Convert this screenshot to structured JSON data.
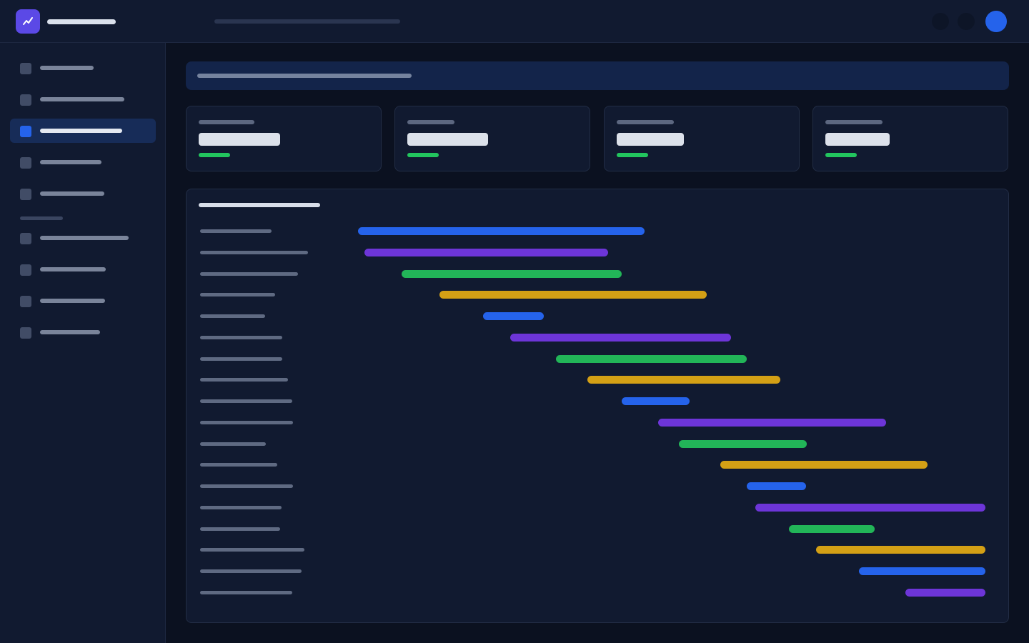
{
  "colors": {
    "accent": "#2563eb",
    "brand": "#5b49e6",
    "positive": "#22c55e",
    "bar_palette": [
      "#2563eb",
      "#6d35d8",
      "#22b558",
      "#d4a015"
    ]
  },
  "topbar": {
    "logo_icon": "trend-line-icon",
    "icons": [
      "circle-icon",
      "circle-icon"
    ],
    "avatar_icon": "avatar-icon"
  },
  "sidebar": {
    "active_index": 2,
    "groups": [
      {
        "items": [
          {
            "label": "",
            "icon": "square-icon"
          },
          {
            "label": "",
            "icon": "square-icon"
          },
          {
            "label": "",
            "icon": "square-icon"
          },
          {
            "label": "",
            "icon": "square-icon"
          },
          {
            "label": "",
            "icon": "square-icon"
          }
        ]
      },
      {
        "items": [
          {
            "label": "",
            "icon": "square-icon"
          },
          {
            "label": "",
            "icon": "square-icon"
          },
          {
            "label": "",
            "icon": "square-icon"
          },
          {
            "label": "",
            "icon": "square-icon"
          }
        ]
      }
    ]
  },
  "stats": [
    {
      "label": "",
      "value": "",
      "delta": ""
    },
    {
      "label": "",
      "value": "",
      "delta": ""
    },
    {
      "label": "",
      "value": "",
      "delta": ""
    },
    {
      "label": "",
      "value": "",
      "delta": ""
    }
  ],
  "chart_data": {
    "type": "gantt",
    "title": "",
    "xlabel": "",
    "ylabel": "",
    "xlim": [
      0,
      100
    ],
    "grid": false,
    "legend": "none",
    "tasks": [
      {
        "name": "",
        "start": 0.0,
        "end": 45.0,
        "color_index": 0
      },
      {
        "name": "",
        "start": 1.0,
        "end": 39.2,
        "color_index": 1
      },
      {
        "name": "",
        "start": 6.8,
        "end": 41.4,
        "color_index": 2
      },
      {
        "name": "",
        "start": 12.8,
        "end": 54.7,
        "color_index": 3
      },
      {
        "name": "",
        "start": 19.6,
        "end": 29.1,
        "color_index": 0
      },
      {
        "name": "",
        "start": 23.9,
        "end": 58.5,
        "color_index": 1
      },
      {
        "name": "",
        "start": 31.1,
        "end": 61.0,
        "color_index": 2
      },
      {
        "name": "",
        "start": 36.0,
        "end": 66.3,
        "color_index": 3
      },
      {
        "name": "",
        "start": 41.4,
        "end": 52.0,
        "color_index": 0
      },
      {
        "name": "",
        "start": 47.1,
        "end": 82.8,
        "color_index": 1
      },
      {
        "name": "",
        "start": 50.3,
        "end": 70.4,
        "color_index": 2
      },
      {
        "name": "",
        "start": 56.8,
        "end": 89.4,
        "color_index": 3
      },
      {
        "name": "",
        "start": 61.0,
        "end": 70.3,
        "color_index": 0
      },
      {
        "name": "",
        "start": 62.3,
        "end": 98.4,
        "color_index": 1
      },
      {
        "name": "",
        "start": 67.6,
        "end": 81.1,
        "color_index": 2
      },
      {
        "name": "",
        "start": 71.9,
        "end": 98.4,
        "color_index": 3
      },
      {
        "name": "",
        "start": 78.6,
        "end": 98.4,
        "color_index": 0
      },
      {
        "name": "",
        "start": 85.9,
        "end": 98.4,
        "color_index": 1
      }
    ]
  }
}
